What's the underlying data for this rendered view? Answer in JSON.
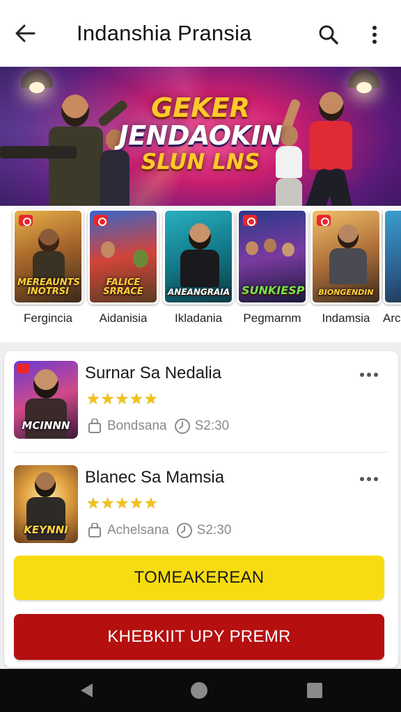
{
  "app_bar": {
    "title": "Indanshia Pransia",
    "back_icon": "arrow-back-icon",
    "search_icon": "search-icon",
    "more_icon": "more-vert-icon"
  },
  "banner": {
    "line1": "GEKER",
    "line2": "JENDAOKIN",
    "line3": "SLUN LNS"
  },
  "games": [
    {
      "name": "Fergincia",
      "art_text": "MEREAUNTS INOTRSI"
    },
    {
      "name": "Aidanisia",
      "art_text": "FALICE SRRACE"
    },
    {
      "name": "Ikladania",
      "art_text": "ANEANGRAIA"
    },
    {
      "name": "Pegmarnm",
      "art_text": "SUNKIESP"
    },
    {
      "name": "Indamsia",
      "art_text": "BIONGENDIN"
    },
    {
      "name": "Arc",
      "art_text": ""
    }
  ],
  "list": [
    {
      "title": "Surnar Sa Nedalia",
      "rating": "★★★★★",
      "category": "Bondsana",
      "duration": "S2:30",
      "art_text": "MCINNN"
    },
    {
      "title": "Blanec Sa Mamsia",
      "rating": "★★★★★",
      "category": "Achelsana",
      "duration": "S2:30",
      "art_text": "KEYNNI"
    }
  ],
  "buttons": {
    "primary": "TOMEAKEREAN",
    "secondary": "KHEBKIIT UPY PREMR"
  },
  "colors": {
    "accent_yellow": "#f6dc11",
    "accent_red": "#b50f10",
    "star": "#f2c21b"
  }
}
